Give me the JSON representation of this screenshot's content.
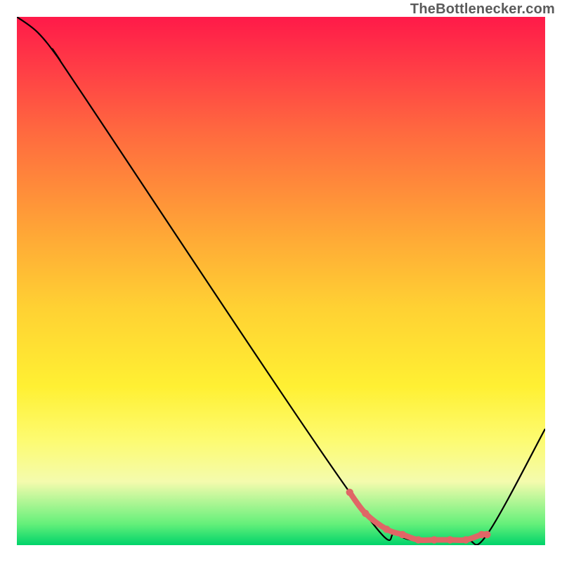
{
  "attribution": "TheBottlenecker.com",
  "colors": {
    "curve_stroke": "#000000",
    "marker_stroke": "#e06666",
    "marker_fill": "#e06666"
  },
  "chart_data": {
    "type": "line",
    "title": "",
    "xlabel": "",
    "ylabel": "",
    "xlim": [
      0,
      100
    ],
    "ylim": [
      0,
      100
    ],
    "series": [
      {
        "name": "curve",
        "x": [
          0,
          4,
          8,
          12,
          63,
          72,
          78,
          85,
          89,
          100
        ],
        "y": [
          100,
          97,
          92,
          86,
          10,
          2,
          1,
          1,
          2,
          22
        ]
      },
      {
        "name": "low-region-markers",
        "x": [
          63,
          66,
          70,
          73,
          76,
          79,
          82,
          85,
          88,
          89
        ],
        "y": [
          10,
          6,
          3,
          2,
          1,
          1,
          1,
          1,
          2,
          2
        ]
      }
    ]
  }
}
